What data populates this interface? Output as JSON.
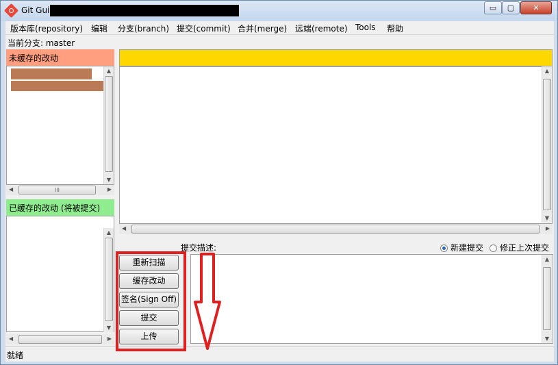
{
  "window": {
    "title": "Git Gui",
    "minimize_glyph": "▭",
    "maximize_glyph": "▢",
    "close_glyph": "✕"
  },
  "menu": [
    "版本库(repository)",
    "编辑",
    "分支(branch)",
    "提交(commit)",
    "合并(merge)",
    "远端(remote)",
    "Tools",
    "帮助"
  ],
  "branch_line": "当前分支: master",
  "unstaged": {
    "header": "未缓存的改动"
  },
  "staged": {
    "header": "已缓存的改动 (将被提交)"
  },
  "scroll": {
    "h_thumb_grip": "III"
  },
  "commit": {
    "label": "提交描述:",
    "option_new": "新建提交",
    "option_amend": "修正上次提交"
  },
  "buttons": {
    "rescan": "重新扫描",
    "stage": "缓存改动",
    "signoff": "签名(Sign Off)",
    "commit": "提交",
    "push": "上传"
  },
  "status": "就绪",
  "colors": {
    "unstaged_header": "#ff9f7f",
    "staged_header": "#8fec8f",
    "diff_header": "#ffd700",
    "annotation": "#e02020"
  }
}
